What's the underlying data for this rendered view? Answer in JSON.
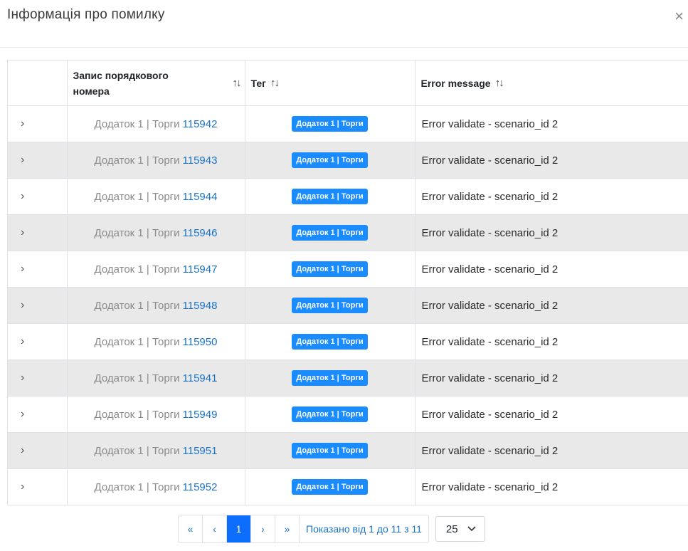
{
  "modal": {
    "title": "Інформація про помилку",
    "close_icon": "×"
  },
  "table": {
    "headers": {
      "record": "Запис порядкового номера",
      "tag": "Тег",
      "error": "Error message"
    },
    "sort_icon": "↑↓",
    "expand_icon": "›",
    "rows": [
      {
        "record_text": "Додаток 1 | Торги",
        "record_num": "115942",
        "tag": "Додаток 1 | Торги",
        "error": "Error validate - scenario_id 2"
      },
      {
        "record_text": "Додаток 1 | Торги",
        "record_num": "115943",
        "tag": "Додаток 1 | Торги",
        "error": "Error validate - scenario_id 2"
      },
      {
        "record_text": "Додаток 1 | Торги",
        "record_num": "115944",
        "tag": "Додаток 1 | Торги",
        "error": "Error validate - scenario_id 2"
      },
      {
        "record_text": "Додаток 1 | Торги",
        "record_num": "115946",
        "tag": "Додаток 1 | Торги",
        "error": "Error validate - scenario_id 2"
      },
      {
        "record_text": "Додаток 1 | Торги",
        "record_num": "115947",
        "tag": "Додаток 1 | Торги",
        "error": "Error validate - scenario_id 2"
      },
      {
        "record_text": "Додаток 1 | Торги",
        "record_num": "115948",
        "tag": "Додаток 1 | Торги",
        "error": "Error validate - scenario_id 2"
      },
      {
        "record_text": "Додаток 1 | Торги",
        "record_num": "115950",
        "tag": "Додаток 1 | Торги",
        "error": "Error validate - scenario_id 2"
      },
      {
        "record_text": "Додаток 1 | Торги",
        "record_num": "115941",
        "tag": "Додаток 1 | Торги",
        "error": "Error validate - scenario_id 2"
      },
      {
        "record_text": "Додаток 1 | Торги",
        "record_num": "115949",
        "tag": "Додаток 1 | Торги",
        "error": "Error validate - scenario_id 2"
      },
      {
        "record_text": "Додаток 1 | Торги",
        "record_num": "115951",
        "tag": "Додаток 1 | Торги",
        "error": "Error validate - scenario_id 2"
      },
      {
        "record_text": "Додаток 1 | Торги",
        "record_num": "115952",
        "tag": "Додаток 1 | Торги",
        "error": "Error validate - scenario_id 2"
      }
    ]
  },
  "pagination": {
    "first": "«",
    "prev": "‹",
    "current": "1",
    "next": "›",
    "last": "»",
    "info": "Показано від 1 до 11 з 11",
    "page_size": "25",
    "page_size_icon": "chevron-down-icon"
  },
  "colors": {
    "accent": "#0d6efd",
    "link": "#1a73c8",
    "tag_bg": "#1a8cff",
    "stripe": "#e9e9e9"
  }
}
